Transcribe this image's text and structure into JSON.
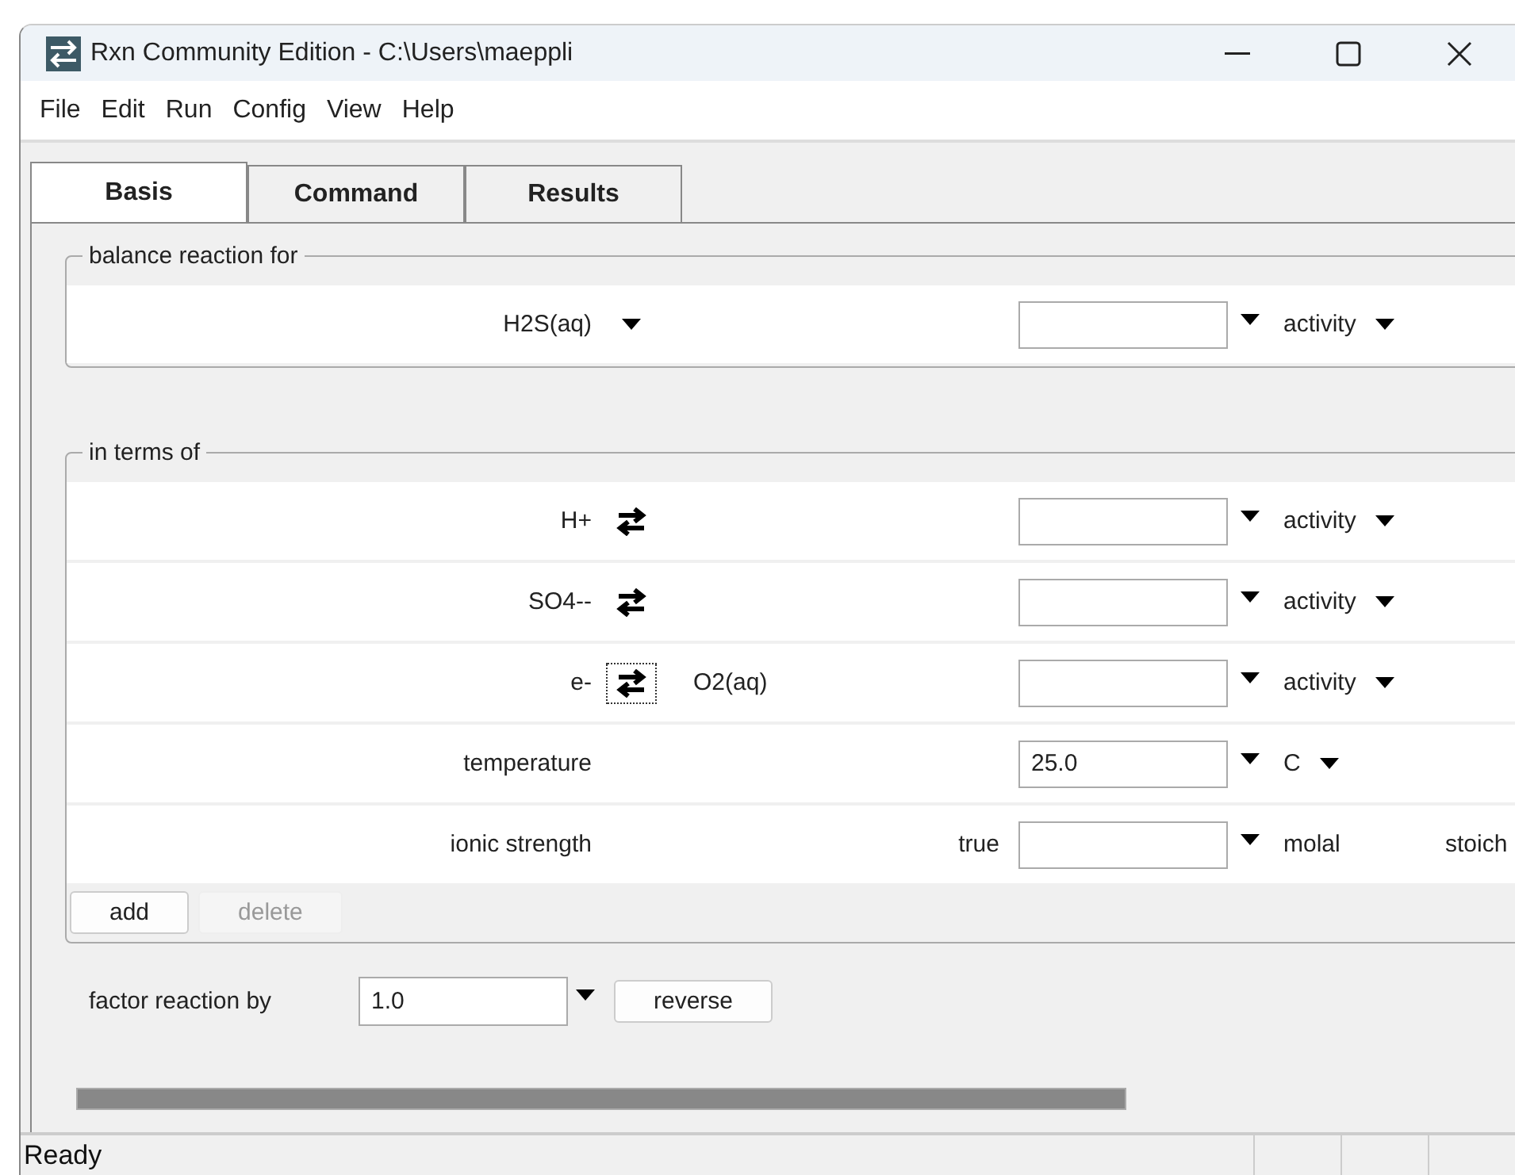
{
  "window": {
    "title": "Rxn Community Edition - C:\\Users\\maeppli"
  },
  "menu": [
    "File",
    "Edit",
    "Run",
    "Config",
    "View",
    "Help"
  ],
  "tabs": [
    {
      "label": "Basis",
      "selected": true
    },
    {
      "label": "Command",
      "selected": false
    },
    {
      "label": "Results",
      "selected": false
    }
  ],
  "balance": {
    "title": "balance reaction for",
    "rows": [
      {
        "kind": "dropdown",
        "label": "H2S(aq)",
        "unit": "activity",
        "unit_dropdown": true
      }
    ]
  },
  "terms": {
    "title": "in terms of",
    "rows": [
      {
        "kind": "swap",
        "label": "H+",
        "focused": false,
        "unit": "activity",
        "unit_dropdown": true
      },
      {
        "kind": "swap",
        "label": "SO4--",
        "focused": false,
        "unit": "activity",
        "unit_dropdown": true
      },
      {
        "kind": "swap",
        "label": "e-",
        "focused": true,
        "partner": "O2(aq)",
        "unit": "activity",
        "unit_dropdown": true
      },
      {
        "kind": "plain",
        "label": "temperature",
        "value": "25.0",
        "unit": "C",
        "unit_dropdown": true
      },
      {
        "kind": "plain",
        "label": "ionic strength",
        "qualifier": "true",
        "unit": "molal",
        "unit_dropdown": false,
        "extra": "stoich"
      }
    ],
    "buttons": [
      {
        "label": "add",
        "disabled": false
      },
      {
        "label": "delete",
        "disabled": true
      }
    ]
  },
  "factor": {
    "label": "factor reaction by",
    "value": "1.0",
    "button": "reverse"
  },
  "status_bar": {
    "text": "Ready"
  }
}
